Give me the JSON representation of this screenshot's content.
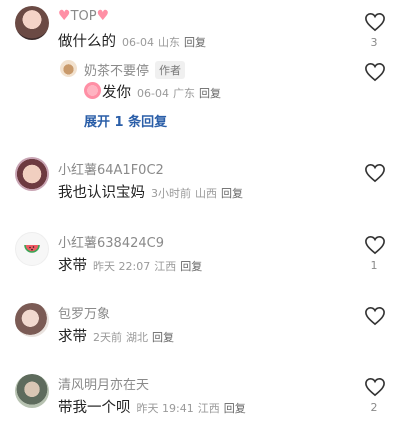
{
  "comments": [
    {
      "user": "TOP",
      "text": "做什么的",
      "date": "06-04",
      "location": "山东",
      "reply_label": "回复",
      "likes": "3",
      "replies": [
        {
          "user": "奶茶不要停",
          "badge": "作者",
          "text": "发你",
          "date": "06-04",
          "location": "广东",
          "reply_label": "回复"
        }
      ],
      "expand_label": "展开 1 条回复"
    },
    {
      "user": "小红薯64A1F0C2",
      "text": "我也认识宝妈",
      "date": "3小时前",
      "location": "山西",
      "reply_label": "回复",
      "likes": ""
    },
    {
      "user": "小红薯638424C9",
      "text": "求带",
      "date": "昨天 22:07",
      "location": "江西",
      "reply_label": "回复",
      "likes": "1"
    },
    {
      "user": "包罗万象",
      "text": "求带",
      "date": "2天前",
      "location": "湖北",
      "reply_label": "回复",
      "likes": ""
    },
    {
      "user": "清风明月亦在天",
      "text": "带我一个呗",
      "date": "昨天 19:41",
      "location": "江西",
      "reply_label": "回复",
      "likes": "2"
    }
  ],
  "icons": {
    "like": "heart-outline-icon",
    "top_heart": "pink-heart-icon"
  },
  "colors": {
    "link": "#2a5ea8",
    "accent_pink": "#ff8fa5"
  }
}
